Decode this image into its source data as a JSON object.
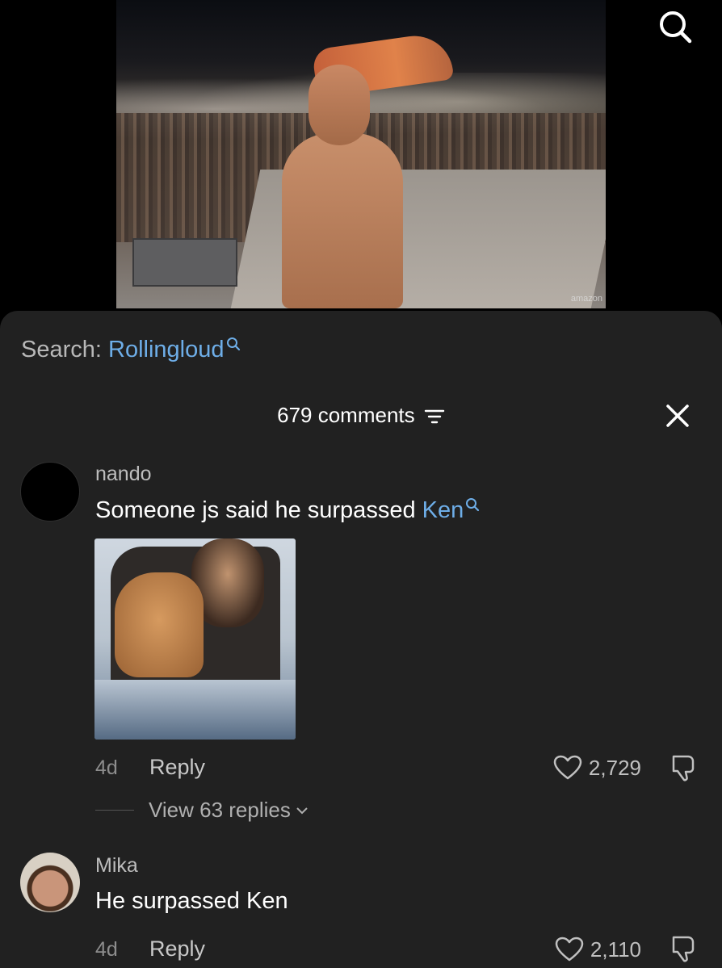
{
  "video": {
    "watermark": "amazon"
  },
  "search_banner": {
    "prefix": "Search: ",
    "keyword": "Rollingloud"
  },
  "comments_header": {
    "count_label": "679 comments"
  },
  "comments": [
    {
      "username": "nando",
      "text_plain": "Someone js said he surpassed ",
      "text_keyword": "Ken",
      "age": "4d",
      "reply_label": "Reply",
      "likes": "2,729",
      "view_replies": "View 63 replies"
    },
    {
      "username": "Mika",
      "text_plain": "He surpassed Ken",
      "age": "4d",
      "reply_label": "Reply",
      "likes": "2,110"
    }
  ],
  "colors": {
    "sheet_bg": "#212121",
    "keyword": "#6eaee8",
    "background": "#000000"
  },
  "icons": [
    "search-icon",
    "close-icon",
    "filter-icon",
    "heart-icon",
    "dislike-icon",
    "chevron-down-icon"
  ]
}
